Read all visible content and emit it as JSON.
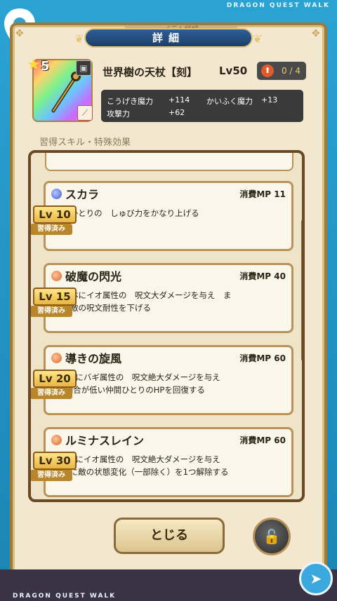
{
  "branding": {
    "top": "DRAGON QUEST WALK",
    "bottom": "DRAGON QUEST WALK"
  },
  "header": {
    "top_banner": "イテム詳細",
    "title": "詳細"
  },
  "item": {
    "rarity": "5",
    "name": "世界樹の天杖【刻】",
    "level": "Lv50",
    "upgrade": "0 / 4",
    "stats": [
      {
        "label": "こうげき魔力",
        "value": "+114"
      },
      {
        "label": "かいふく魔力",
        "value": "+13"
      },
      {
        "label": "攻撃力",
        "value": "+62"
      }
    ]
  },
  "section_label": "習得スキル・特殊効果",
  "skills": [
    {
      "name": "スカラ",
      "element": "blue",
      "mp_label": "消費MP",
      "mp": "11",
      "level": "Lv 10",
      "status": "習得済み",
      "desc": "仲間ひとりの　しゅび力をかなり上げる"
    },
    {
      "name": "破魔の閃光",
      "element": "orange",
      "mp_label": "消費MP",
      "mp": "40",
      "level": "Lv 15",
      "status": "習得済み",
      "desc": "敵全体にイオ属性の　呪文大ダメージを与え　ま\nれに敵の呪文耐性を下げる"
    },
    {
      "name": "導きの旋風",
      "element": "orange",
      "mp_label": "消費MP",
      "mp": "60",
      "level": "Lv 20",
      "status": "習得済み",
      "desc": "敵1体にバギ属性の　呪文絶大ダメージを与え\nHP割合が低い仲間ひとりのHPを回復する"
    },
    {
      "name": "ルミナスレイン",
      "element": "orange",
      "mp_label": "消費MP",
      "mp": "60",
      "level": "Lv 30",
      "status": "習得済み",
      "desc": "敵1体にイオ属性の　呪文絶大ダメージを与え\nたまに敵の状態変化（一部除く）を1つ解除する"
    }
  ],
  "buttons": {
    "close": "とじる"
  },
  "colors": {
    "panel": "#f3e8cf",
    "border": "#9c7a3e",
    "title_bar": "#1c3f6c",
    "frame": "#2aa3d3"
  }
}
